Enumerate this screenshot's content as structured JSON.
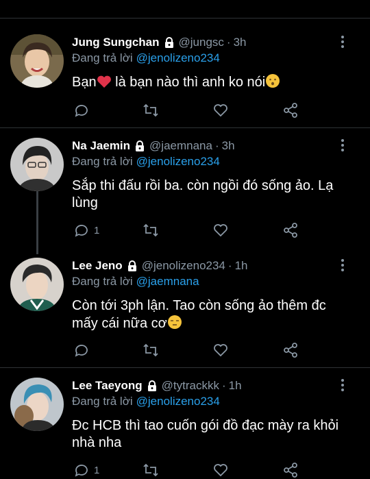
{
  "colors": {
    "background": "#000000",
    "text": "#ffffff",
    "secondary": "#8b98a5",
    "link": "#2aa0ea",
    "divider": "#2f3336"
  },
  "reply_prefix": "Đang trả lời",
  "tweets": [
    {
      "name": "Jung Sungchan",
      "handle": "@jungsc",
      "time": "3h",
      "reply_to": "@jenolizeno234",
      "text": "Bạn",
      "text_after": " là bạn nào thì anh ko nói",
      "emojis": [
        "red-heart",
        "hushed-face"
      ],
      "reply_count": ""
    },
    {
      "name": "Na Jaemin",
      "handle": "@jaemnana",
      "time": "3h",
      "reply_to": "@jenolizeno234",
      "text": "Sắp thi đấu rồi ba. còn ngồi đó sống ảo. Lạ lùng",
      "reply_count": "1"
    },
    {
      "name": "Lee Jeno",
      "handle": "@jenolizeno234",
      "time": "1h",
      "reply_to": "@jaemnana",
      "text": "Còn tới 3ph lận. Tao còn sống ảo thêm đc mấy cái nữa cơ",
      "emojis": [
        "unamused-face"
      ],
      "reply_count": ""
    },
    {
      "name": "Lee Taeyong",
      "handle": "@tytrackkk",
      "time": "1h",
      "reply_to": "@jenolizeno234",
      "text": "Đc HCB thì tao cuốn gói đồ đạc mày ra khỏi nhà nha",
      "reply_count": "1"
    }
  ]
}
